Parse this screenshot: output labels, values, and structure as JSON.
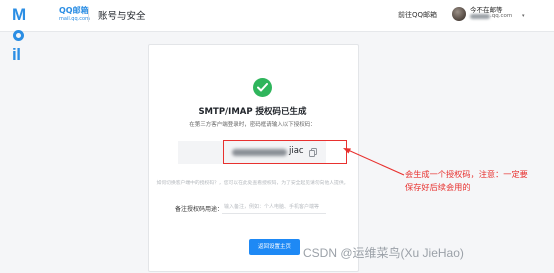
{
  "header": {
    "logo": {
      "word": "Mail",
      "sub": "QQ邮箱",
      "sub2": "mail.qq.com"
    },
    "page_title": "账号与安全",
    "goto_qq": "前往QQ邮箱",
    "user": {
      "name": "今不在邮等",
      "mail": ".qq.com",
      "caret": "▾"
    }
  },
  "card": {
    "title": "SMTP/IMAP 授权码已生成",
    "desc": "在第三方客户端登录时，密码框请输入以下授权码：",
    "code_suffix": "jiac",
    "hint": "如何切换客户端中的授权码？，您可以在此处查看授权码，为了安全起见请勿向他人提供。",
    "remark_label": "备注授权码用途：",
    "remark_placeholder": "输入备注，例如：个人电脑、手机客户端等",
    "back_button": "返回设置主页"
  },
  "annotation": {
    "line1": "会生成一个授权码，注意：一定要",
    "line2": "保存好后续会用的",
    "color": "#e8312f"
  },
  "watermark": "CSDN @运维菜鸟(Xu JieHao)",
  "colors": {
    "brand": "#2b8ee4",
    "success": "#2fb55c",
    "primary_button": "#1e89f5"
  }
}
